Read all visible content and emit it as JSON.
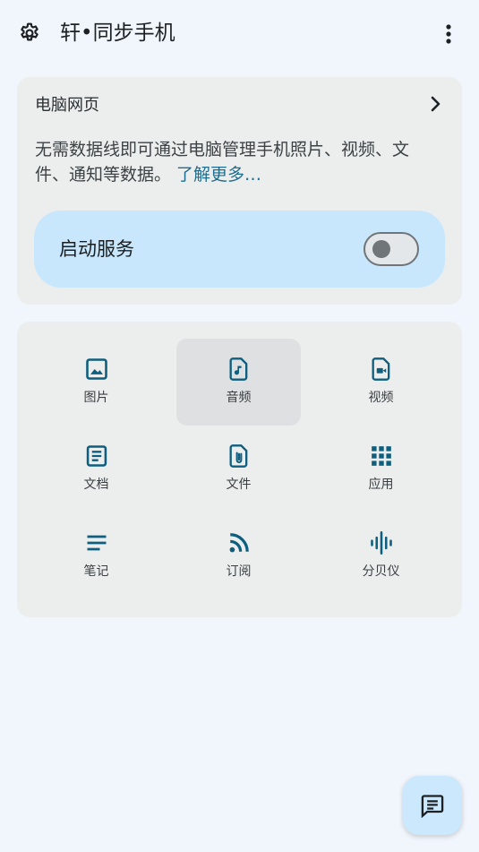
{
  "app": {
    "title": "轩•同步手机"
  },
  "card": {
    "title": "电脑网页",
    "description": "无需数据线即可通过电脑管理手机照片、视频、文件、通知等数据。",
    "learn_more": "了解更多…",
    "service_label": "启动服务",
    "service_enabled": false
  },
  "grid": {
    "items": [
      {
        "label": "图片",
        "icon": "image-icon"
      },
      {
        "label": "音频",
        "icon": "audio-file-icon"
      },
      {
        "label": "视频",
        "icon": "video-file-icon"
      },
      {
        "label": "文档",
        "icon": "document-icon"
      },
      {
        "label": "文件",
        "icon": "attachment-file-icon"
      },
      {
        "label": "应用",
        "icon": "apps-grid-icon"
      },
      {
        "label": "笔记",
        "icon": "notes-icon"
      },
      {
        "label": "订阅",
        "icon": "rss-icon"
      },
      {
        "label": "分贝仪",
        "icon": "sound-meter-icon"
      }
    ],
    "active_index": 1
  },
  "colors": {
    "background": "#f1f6fc",
    "card": "#eceeee",
    "accent_icon": "#0e5e7e",
    "link": "#1e6d8e",
    "pill": "#c9e7fc"
  },
  "fab": {
    "icon": "chat-icon"
  }
}
